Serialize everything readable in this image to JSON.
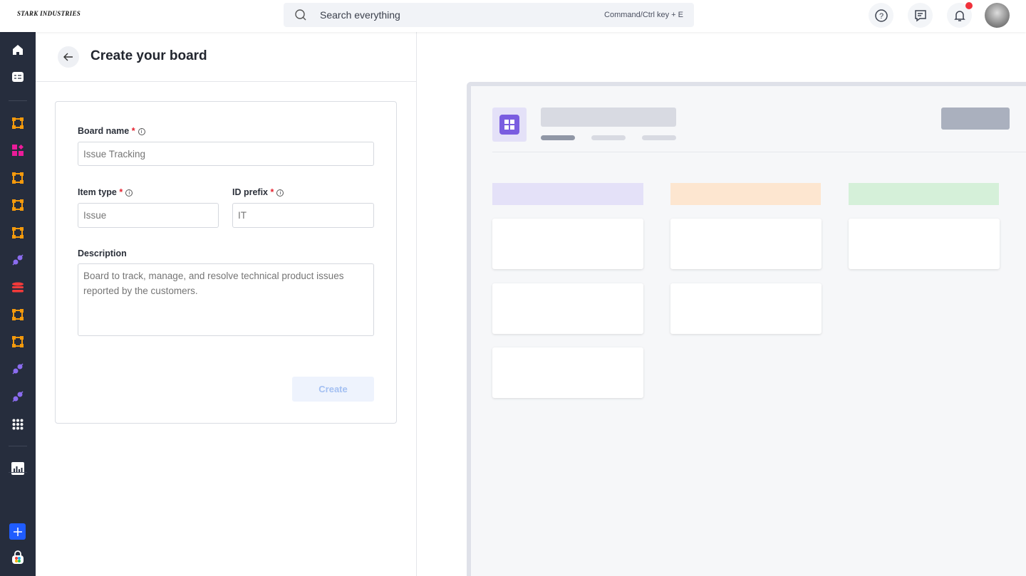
{
  "brand": {
    "logo_text": "STARK INDUSTRIES"
  },
  "search": {
    "placeholder": "Search everything",
    "shortcut": "Command/Ctrl key + E"
  },
  "header": {
    "icons": [
      "help-icon",
      "chat-icon",
      "bell-icon"
    ],
    "notification_color": "#f0313b"
  },
  "form": {
    "title": "Create your board",
    "board_name": {
      "label": "Board name",
      "required": "*",
      "placeholder": "Issue Tracking"
    },
    "item_type": {
      "label": "Item type",
      "required": "*",
      "placeholder": "Issue"
    },
    "id_prefix": {
      "label": "ID prefix",
      "required": "*",
      "placeholder": "IT"
    },
    "description": {
      "label": "Description",
      "placeholder": "Board to track, manage, and resolve technical product issues reported by the customers."
    },
    "create_label": "Create"
  },
  "preview": {
    "column_colors": [
      "#e4e1f8",
      "#fde6d0",
      "#d5f0d9"
    ],
    "accent": "#7a5de0"
  }
}
